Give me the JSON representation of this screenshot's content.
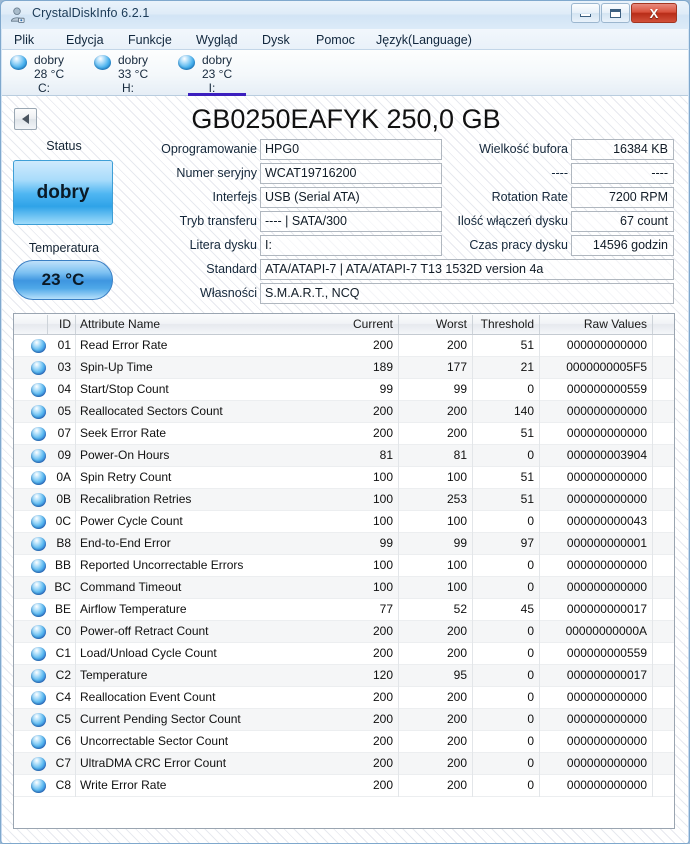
{
  "window": {
    "title": "CrystalDiskInfo 6.2.1",
    "icon": "app-disk-icon",
    "minimize_label": "Minimize",
    "maximize_label": "Maximize",
    "close_label": "X"
  },
  "menu": [
    {
      "label": "Plik"
    },
    {
      "label": "Edycja"
    },
    {
      "label": "Funkcje"
    },
    {
      "label": "Wygląd"
    },
    {
      "label": "Dysk"
    },
    {
      "label": "Pomoc"
    },
    {
      "label": "Język(Language)"
    }
  ],
  "disks": [
    {
      "state": "dobry",
      "temperature": "28 °C",
      "letter": "C:",
      "selected": false
    },
    {
      "state": "dobry",
      "temperature": "33 °C",
      "letter": "H:",
      "selected": false
    },
    {
      "state": "dobry",
      "temperature": "23 °C",
      "letter": "I:",
      "selected": true
    }
  ],
  "drive": {
    "model_title": "GB0250EAFYK 250,0 GB",
    "status_label": "Status",
    "health": "dobry",
    "temperature_label": "Temperatura",
    "temperature": "23 °C"
  },
  "info_left": [
    {
      "label": "Oprogramowanie",
      "value": "HPG0"
    },
    {
      "label": "Numer seryjny",
      "value": "WCAT19716200"
    },
    {
      "label": "Interfejs",
      "value": "USB (Serial ATA)"
    },
    {
      "label": "Tryb transferu",
      "value": "---- | SATA/300"
    },
    {
      "label": "Litera dysku",
      "value": "I:"
    }
  ],
  "info_right": [
    {
      "label": "Wielkość bufora",
      "value": "16384 KB"
    },
    {
      "label": "----",
      "value": "----"
    },
    {
      "label": "Rotation Rate",
      "value": "7200 RPM"
    },
    {
      "label": "Ilość włączeń dysku",
      "value": "67 count"
    },
    {
      "label": "Czas pracy dysku",
      "value": "14596 godzin"
    }
  ],
  "info_wide": [
    {
      "label": "Standard",
      "value": "ATA/ATAPI-7 | ATA/ATAPI-7 T13 1532D version 4a"
    },
    {
      "label": "Własności",
      "value": "S.M.A.R.T., NCQ"
    }
  ],
  "smart_table": {
    "columns": [
      "",
      "ID",
      "Attribute Name",
      "Current",
      "Worst",
      "Threshold",
      "Raw Values"
    ],
    "rows": [
      {
        "id": "01",
        "name": "Read Error Rate",
        "current": "200",
        "worst": "200",
        "threshold": "51",
        "raw": "000000000000"
      },
      {
        "id": "03",
        "name": "Spin-Up Time",
        "current": "189",
        "worst": "177",
        "threshold": "21",
        "raw": "0000000005F5"
      },
      {
        "id": "04",
        "name": "Start/Stop Count",
        "current": "99",
        "worst": "99",
        "threshold": "0",
        "raw": "000000000559"
      },
      {
        "id": "05",
        "name": "Reallocated Sectors Count",
        "current": "200",
        "worst": "200",
        "threshold": "140",
        "raw": "000000000000"
      },
      {
        "id": "07",
        "name": "Seek Error Rate",
        "current": "200",
        "worst": "200",
        "threshold": "51",
        "raw": "000000000000"
      },
      {
        "id": "09",
        "name": "Power-On Hours",
        "current": "81",
        "worst": "81",
        "threshold": "0",
        "raw": "000000003904"
      },
      {
        "id": "0A",
        "name": "Spin Retry Count",
        "current": "100",
        "worst": "100",
        "threshold": "51",
        "raw": "000000000000"
      },
      {
        "id": "0B",
        "name": "Recalibration Retries",
        "current": "100",
        "worst": "253",
        "threshold": "51",
        "raw": "000000000000"
      },
      {
        "id": "0C",
        "name": "Power Cycle Count",
        "current": "100",
        "worst": "100",
        "threshold": "0",
        "raw": "000000000043"
      },
      {
        "id": "B8",
        "name": "End-to-End Error",
        "current": "99",
        "worst": "99",
        "threshold": "97",
        "raw": "000000000001"
      },
      {
        "id": "BB",
        "name": "Reported Uncorrectable Errors",
        "current": "100",
        "worst": "100",
        "threshold": "0",
        "raw": "000000000000"
      },
      {
        "id": "BC",
        "name": "Command Timeout",
        "current": "100",
        "worst": "100",
        "threshold": "0",
        "raw": "000000000000"
      },
      {
        "id": "BE",
        "name": "Airflow Temperature",
        "current": "77",
        "worst": "52",
        "threshold": "45",
        "raw": "000000000017"
      },
      {
        "id": "C0",
        "name": "Power-off Retract Count",
        "current": "200",
        "worst": "200",
        "threshold": "0",
        "raw": "00000000000A"
      },
      {
        "id": "C1",
        "name": "Load/Unload Cycle Count",
        "current": "200",
        "worst": "200",
        "threshold": "0",
        "raw": "000000000559"
      },
      {
        "id": "C2",
        "name": "Temperature",
        "current": "120",
        "worst": "95",
        "threshold": "0",
        "raw": "000000000017"
      },
      {
        "id": "C4",
        "name": "Reallocation Event Count",
        "current": "200",
        "worst": "200",
        "threshold": "0",
        "raw": "000000000000"
      },
      {
        "id": "C5",
        "name": "Current Pending Sector Count",
        "current": "200",
        "worst": "200",
        "threshold": "0",
        "raw": "000000000000"
      },
      {
        "id": "C6",
        "name": "Uncorrectable Sector Count",
        "current": "200",
        "worst": "200",
        "threshold": "0",
        "raw": "000000000000"
      },
      {
        "id": "C7",
        "name": "UltraDMA CRC Error Count",
        "current": "200",
        "worst": "200",
        "threshold": "0",
        "raw": "000000000000"
      },
      {
        "id": "C8",
        "name": "Write Error Rate",
        "current": "200",
        "worst": "200",
        "threshold": "0",
        "raw": "000000000000"
      }
    ]
  },
  "colors": {
    "good_blue": "#2fa3e8",
    "selected_tab": "#3b1fbe",
    "close_red": "#d9513c"
  }
}
